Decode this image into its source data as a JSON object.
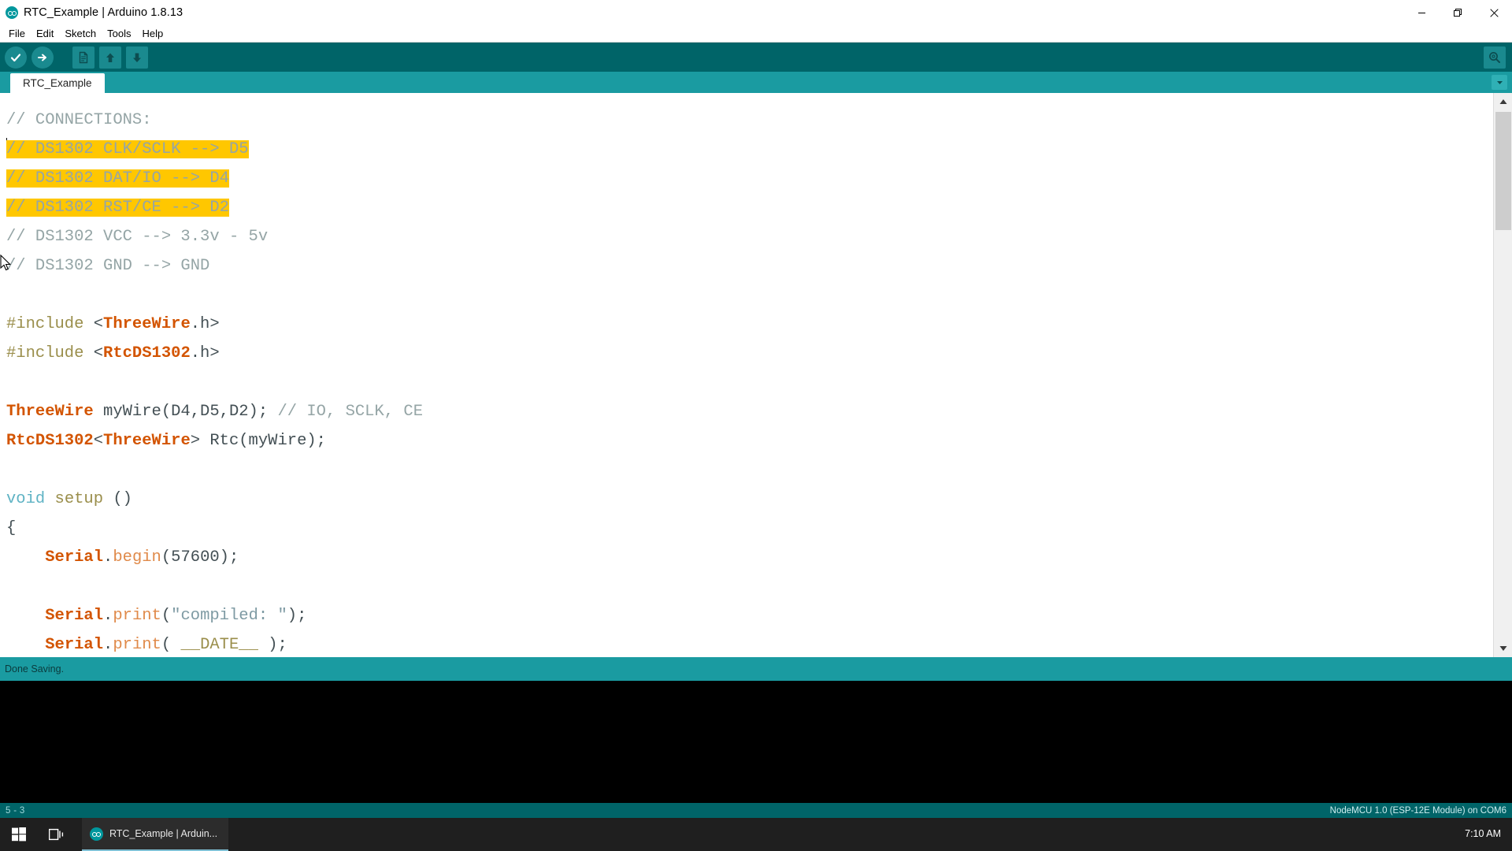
{
  "window": {
    "title": "RTC_Example | Arduino 1.8.13",
    "app_icon": "arduino-infinity-icon",
    "controls": [
      {
        "name": "minimize",
        "glyph": "minimize-icon"
      },
      {
        "name": "restore",
        "glyph": "restore-icon"
      },
      {
        "name": "close",
        "glyph": "close-icon"
      }
    ]
  },
  "menubar": {
    "items": [
      "File",
      "Edit",
      "Sketch",
      "Tools",
      "Help"
    ]
  },
  "toolbar": {
    "buttons": [
      {
        "name": "verify-button",
        "icon": "check-icon",
        "tooltip": "Verify"
      },
      {
        "name": "upload-button",
        "icon": "arrow-right-icon",
        "tooltip": "Upload"
      },
      {
        "name": "new-button",
        "icon": "new-file-icon",
        "tooltip": "New"
      },
      {
        "name": "open-button",
        "icon": "arrow-up-icon",
        "tooltip": "Open"
      },
      {
        "name": "save-button",
        "icon": "arrow-down-icon",
        "tooltip": "Save"
      }
    ],
    "serial_monitor": {
      "name": "serial-monitor-button",
      "icon": "magnifier-icon",
      "tooltip": "Serial Monitor"
    }
  },
  "tabs": {
    "items": [
      {
        "label": "RTC_Example",
        "active": true
      }
    ],
    "menu_icon": "chevron-down-icon"
  },
  "editor": {
    "lines": [
      {
        "segments": [
          {
            "text": "// CONNECTIONS:",
            "cls": "c-comment"
          }
        ]
      },
      {
        "highlight": true,
        "caret": true,
        "segments": [
          {
            "text": "// DS1302 CLK/SCLK --> D5",
            "cls": "c-comment"
          }
        ]
      },
      {
        "highlight": true,
        "segments": [
          {
            "text": "// DS1302 DAT/IO --> D4",
            "cls": "c-comment"
          }
        ]
      },
      {
        "highlight": true,
        "segments": [
          {
            "text": "// DS1302 RST/CE --> D2",
            "cls": "c-comment"
          }
        ]
      },
      {
        "segments": [
          {
            "text": "// DS1302 VCC --> 3.3v - 5v",
            "cls": "c-comment"
          }
        ]
      },
      {
        "segments": [
          {
            "text": "// DS1302 GND --> GND",
            "cls": "c-comment"
          }
        ]
      },
      {
        "segments": []
      },
      {
        "segments": [
          {
            "text": "#include ",
            "cls": "c-pre"
          },
          {
            "text": "<",
            "cls": "c-punct"
          },
          {
            "text": "ThreeWire",
            "cls": "c-lib"
          },
          {
            "text": ".h>",
            "cls": "c-punct"
          }
        ]
      },
      {
        "segments": [
          {
            "text": "#include ",
            "cls": "c-pre"
          },
          {
            "text": "<",
            "cls": "c-punct"
          },
          {
            "text": "RtcDS1302",
            "cls": "c-lib"
          },
          {
            "text": ".h>",
            "cls": "c-punct"
          }
        ]
      },
      {
        "segments": []
      },
      {
        "segments": [
          {
            "text": "ThreeWire",
            "cls": "c-type"
          },
          {
            "text": " myWire(D4,D5,D2); ",
            "cls": "c-plain"
          },
          {
            "text": "// IO, SCLK, CE",
            "cls": "c-comment"
          }
        ]
      },
      {
        "segments": [
          {
            "text": "RtcDS1302",
            "cls": "c-type"
          },
          {
            "text": "<",
            "cls": "c-punct"
          },
          {
            "text": "ThreeWire",
            "cls": "c-type"
          },
          {
            "text": "> Rtc(myWire);",
            "cls": "c-plain"
          }
        ]
      },
      {
        "segments": []
      },
      {
        "segments": [
          {
            "text": "void",
            "cls": "c-kw"
          },
          {
            "text": " ",
            "cls": "c-plain"
          },
          {
            "text": "setup",
            "cls": "c-fn"
          },
          {
            "text": " ()",
            "cls": "c-plain"
          }
        ]
      },
      {
        "segments": [
          {
            "text": "{",
            "cls": "c-plain"
          }
        ]
      },
      {
        "segments": [
          {
            "text": "    ",
            "cls": "c-plain"
          },
          {
            "text": "Serial",
            "cls": "c-obj"
          },
          {
            "text": ".",
            "cls": "c-plain"
          },
          {
            "text": "begin",
            "cls": "c-method"
          },
          {
            "text": "(57600);",
            "cls": "c-plain"
          }
        ]
      },
      {
        "segments": []
      },
      {
        "segments": [
          {
            "text": "    ",
            "cls": "c-plain"
          },
          {
            "text": "Serial",
            "cls": "c-obj"
          },
          {
            "text": ".",
            "cls": "c-plain"
          },
          {
            "text": "print",
            "cls": "c-method"
          },
          {
            "text": "(",
            "cls": "c-plain"
          },
          {
            "text": "\"compiled: \"",
            "cls": "c-str"
          },
          {
            "text": ");",
            "cls": "c-plain"
          }
        ]
      },
      {
        "segments": [
          {
            "text": "    ",
            "cls": "c-plain"
          },
          {
            "text": "Serial",
            "cls": "c-obj"
          },
          {
            "text": ".",
            "cls": "c-plain"
          },
          {
            "text": "print",
            "cls": "c-method"
          },
          {
            "text": "( ",
            "cls": "c-plain"
          },
          {
            "text": "__DATE__",
            "cls": "c-fn"
          },
          {
            "text": " );",
            "cls": "c-plain"
          }
        ]
      }
    ],
    "selection_color": "#ffc700",
    "scrollbar": {
      "up_icon": "scroll-up-icon",
      "down_icon": "scroll-down-icon"
    }
  },
  "status": {
    "message": "Done Saving.",
    "console_text": ""
  },
  "bottombar": {
    "cursor_position": "5 - 3",
    "board_info": "NodeMCU 1.0 (ESP-12E Module) on COM6"
  },
  "taskbar": {
    "start_icon": "windows-start-icon",
    "taskview_icon": "task-view-icon",
    "app": {
      "label": "RTC_Example | Arduin...",
      "icon": "arduino-infinity-icon"
    },
    "clock": "7:10 AM"
  },
  "colors": {
    "accent_teal": "#006468",
    "tab_teal": "#1a9ba1",
    "highlight": "#ffc700",
    "keyword": "#5fb3c4",
    "comment": "#95a5a6",
    "type": "#d35400"
  }
}
